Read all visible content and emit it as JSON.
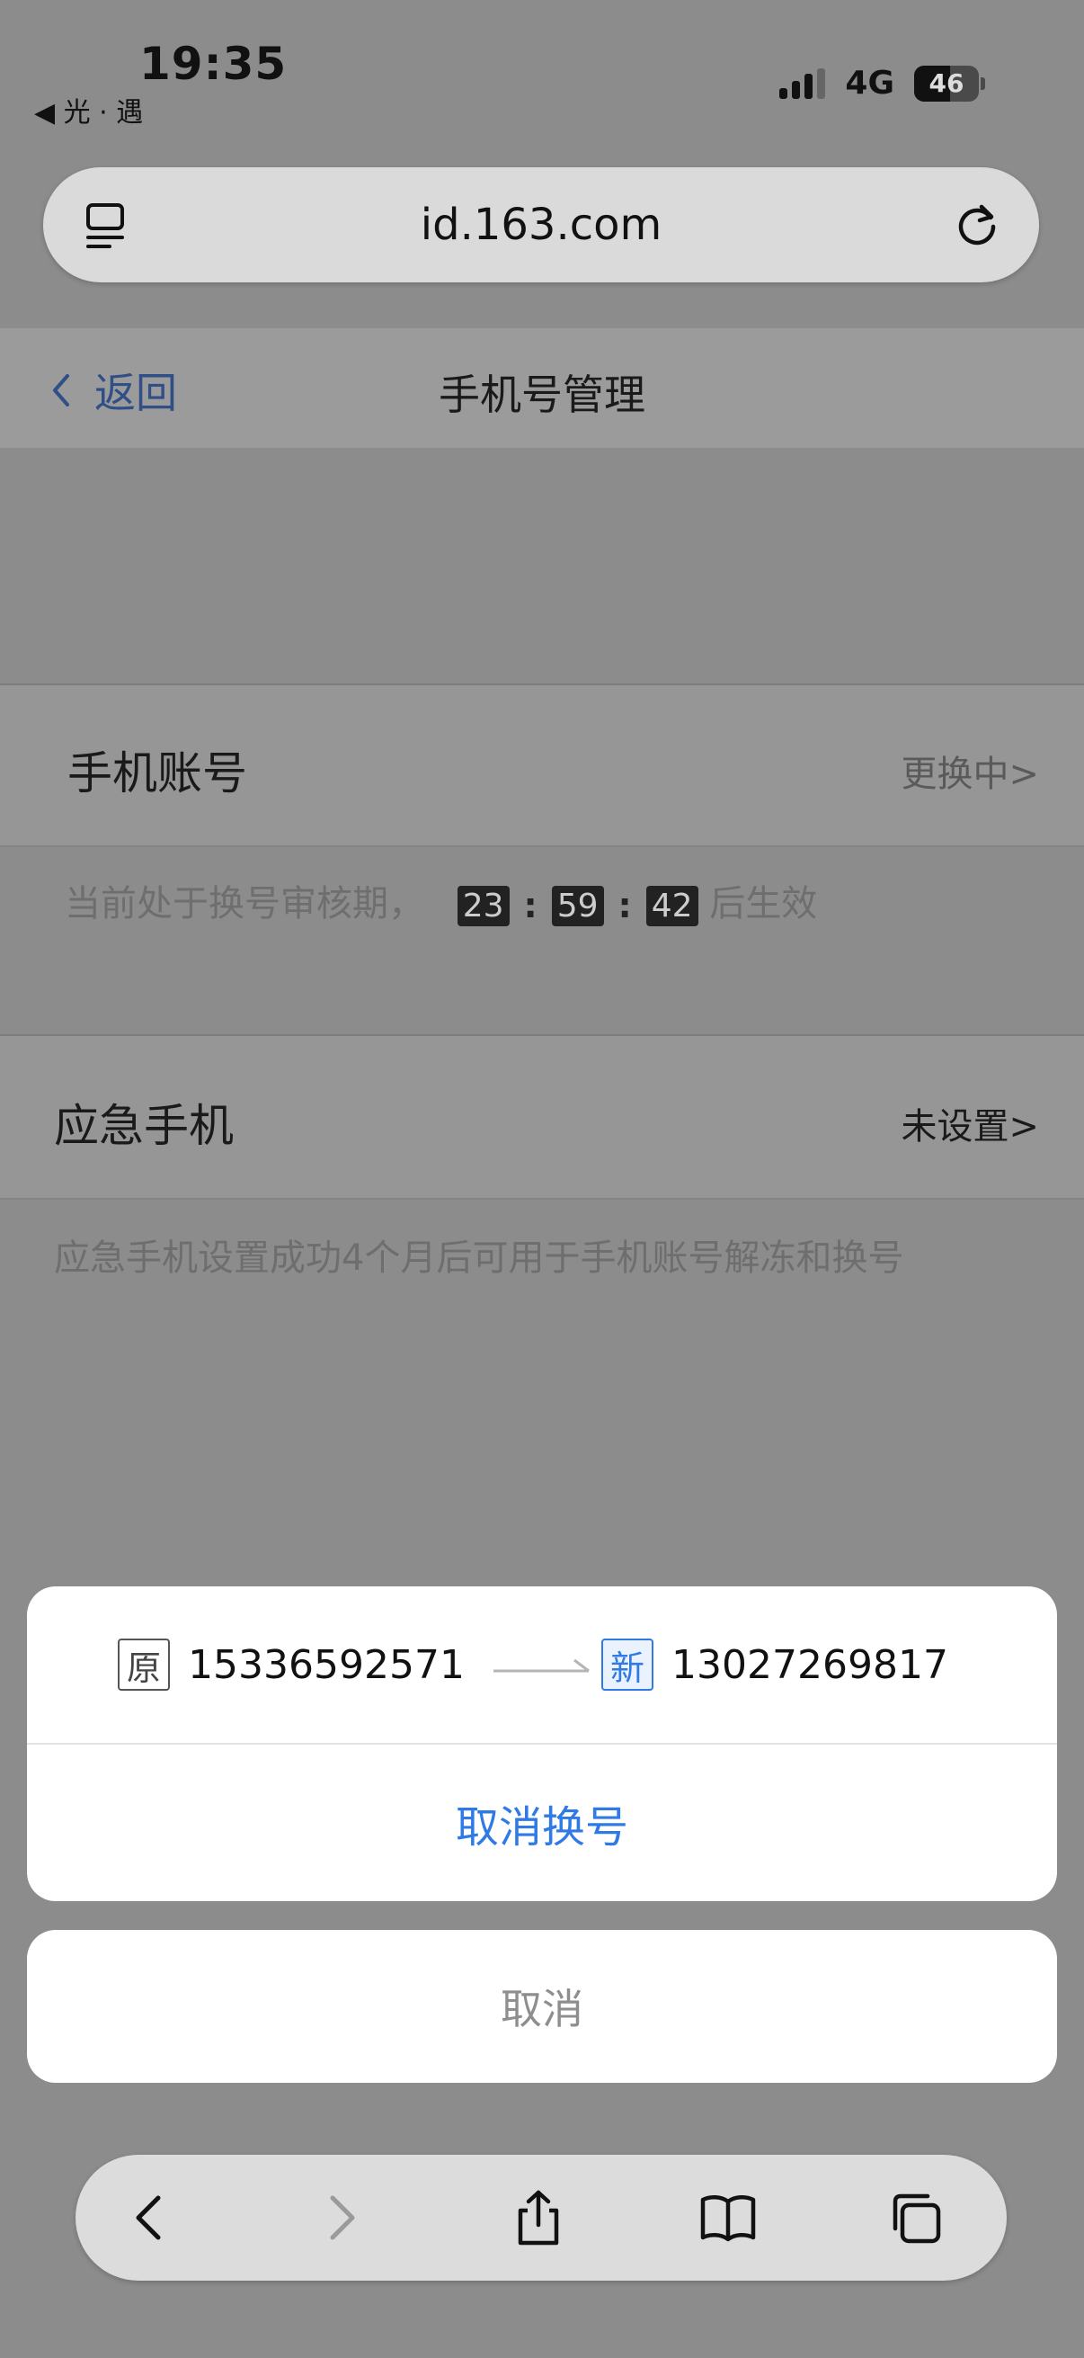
{
  "status_bar": {
    "time": "19:35",
    "back_app": "◀ 光 · 遇",
    "network": "4G",
    "battery": "46"
  },
  "browser": {
    "url": "id.163.com"
  },
  "page": {
    "back_label": "返回",
    "title": "手机号管理",
    "phone_account": {
      "label": "手机账号",
      "value": "更换中>",
      "hint_prefix": "当前处于换号审核期，",
      "countdown": {
        "hours": "23",
        "minutes": "59",
        "seconds": "42"
      },
      "hint_suffix": "后生效"
    },
    "emergency_phone": {
      "label": "应急手机",
      "value": "未设置>",
      "hint": "应急手机设置成功4个月后可用于手机账号解冻和换号"
    }
  },
  "action_sheet": {
    "old_tag": "原",
    "old_number": "15336592571",
    "new_tag": "新",
    "new_number": "13027269817",
    "action_label": "取消换号",
    "cancel_label": "取消"
  },
  "colors": {
    "accent": "#2f7ae5",
    "nav_link": "#2f4f86"
  }
}
